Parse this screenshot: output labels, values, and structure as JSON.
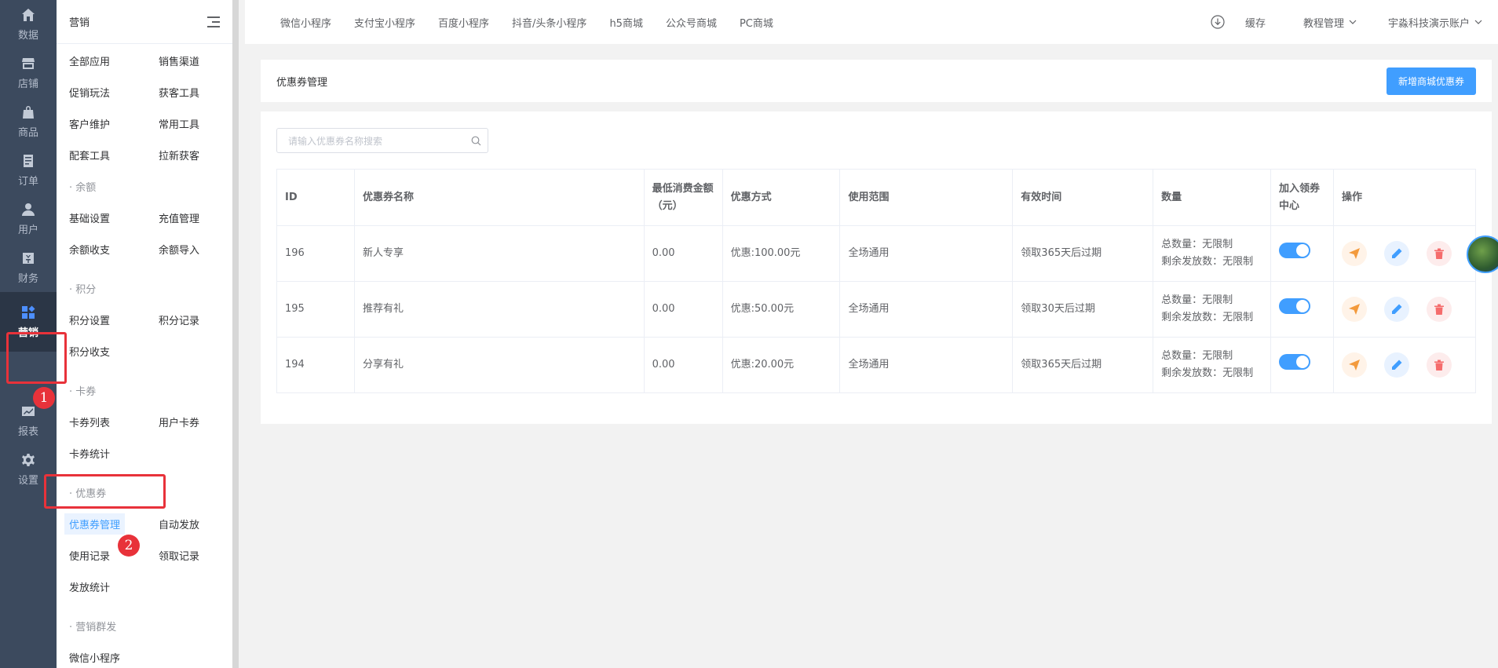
{
  "rail": {
    "items": [
      {
        "label": "数据",
        "icon": "home-icon"
      },
      {
        "label": "店铺",
        "icon": "store-icon"
      },
      {
        "label": "商品",
        "icon": "bag-icon"
      },
      {
        "label": "订单",
        "icon": "order-icon"
      },
      {
        "label": "用户",
        "icon": "user-icon"
      },
      {
        "label": "财务",
        "icon": "finance-icon"
      },
      {
        "label": "营销",
        "icon": "marketing-icon",
        "active": true
      },
      {
        "label": "报表",
        "icon": "report-icon"
      },
      {
        "label": "设置",
        "icon": "gear-icon"
      }
    ]
  },
  "sidebar": {
    "title": "营销",
    "rows": [
      [
        "全部应用",
        "销售渠道"
      ],
      [
        "促销玩法",
        "获客工具"
      ],
      [
        "客户维护",
        "常用工具"
      ],
      [
        "配套工具",
        "拉新获客"
      ]
    ],
    "groups": {
      "balance": {
        "title": "· 余额",
        "items": [
          "基础设置",
          "充值管理",
          "余额收支",
          "余额导入"
        ]
      },
      "points": {
        "title": "· 积分",
        "items": [
          "积分设置",
          "积分记录",
          "积分收支"
        ]
      },
      "cards": {
        "title": "· 卡券",
        "items": [
          "卡券列表",
          "用户卡券",
          "卡券统计"
        ]
      },
      "coupons": {
        "title": "· 优惠券",
        "items": [
          "优惠券管理",
          "自动发放",
          "使用记录",
          "领取记录",
          "发放统计"
        ]
      },
      "mass": {
        "title": "· 营销群发",
        "items": [
          "微信小程序"
        ]
      }
    }
  },
  "topnav": {
    "tabs": [
      "微信小程序",
      "支付宝小程序",
      "百度小程序",
      "抖音/头条小程序",
      "h5商城",
      "公众号商城",
      "PC商城"
    ],
    "cache": "缓存",
    "tutorial": "教程管理",
    "account": "宇淼科技演示账户"
  },
  "page": {
    "title": "优惠券管理",
    "add_button": "新增商城优惠券",
    "search_placeholder": "请输入优惠券名称搜索"
  },
  "table": {
    "headers": [
      "ID",
      "优惠券名称",
      "最低消费金额（元）",
      "优惠方式",
      "使用范围",
      "有效时间",
      "数量",
      "加入领券中心",
      "操作"
    ],
    "rows": [
      {
        "id": "196",
        "name": "新人专享",
        "min": "0.00",
        "discount": "优惠:100.00元",
        "scope": "全场通用",
        "valid": "领取365天后过期",
        "total": "总数量：无限制",
        "remain": "剩余发放数：无限制",
        "center": true
      },
      {
        "id": "195",
        "name": "推荐有礼",
        "min": "0.00",
        "discount": "优惠:50.00元",
        "scope": "全场通用",
        "valid": "领取30天后过期",
        "total": "总数量：无限制",
        "remain": "剩余发放数：无限制",
        "center": true
      },
      {
        "id": "194",
        "name": "分享有礼",
        "min": "0.00",
        "discount": "优惠:20.00元",
        "scope": "全场通用",
        "valid": "领取365天后过期",
        "total": "总数量：无限制",
        "remain": "剩余发放数：无限制",
        "center": true
      }
    ]
  },
  "annotations": {
    "badge1": "1",
    "badge2": "2"
  },
  "colors": {
    "primary": "#409eff",
    "rail": "#3c4a5e",
    "marker": "#e8323a"
  }
}
